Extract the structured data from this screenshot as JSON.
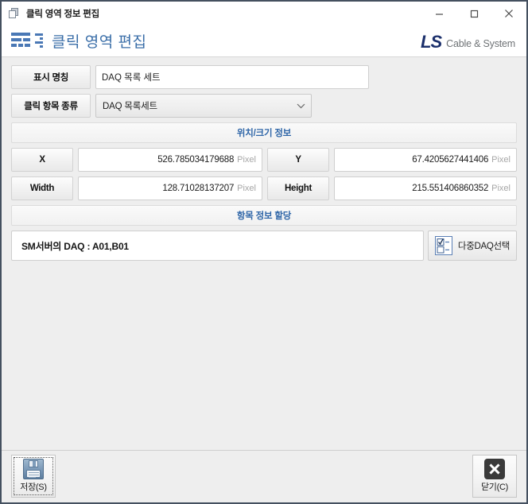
{
  "window": {
    "title": "클릭 영역 정보 편집",
    "title_icon": "copy-pages-icon",
    "controls": {
      "minimize": "minimize-icon",
      "maximize": "maximize-icon",
      "close": "close-icon"
    }
  },
  "header": {
    "icon": "list-bars-icon",
    "title": "클릭 영역 편집",
    "logo": {
      "mark": "LS",
      "text": "Cable & System",
      "mark_color": "#1b2f6b",
      "swoosh_color": "#e2182b",
      "text_color": "#6f7376"
    }
  },
  "form": {
    "display_name": {
      "label": "표시 명칭",
      "value": "DAQ 목록 세트",
      "placeholder": ""
    },
    "click_item_type": {
      "label": "클릭 항목 종류",
      "value": "DAQ 목록세트",
      "options": [
        "DAQ 목록세트"
      ],
      "chevron": "chevron-down-icon"
    }
  },
  "position_section": {
    "title": "위치/크기 정보",
    "accent_color": "#2f66a8",
    "unit": "Pixel",
    "fields": [
      {
        "label": "X",
        "value": "526.785034179688",
        "unit": "Pixel"
      },
      {
        "label": "Y",
        "value": "67.4205627441406",
        "unit": "Pixel"
      },
      {
        "label": "Width",
        "value": "128.71028137207",
        "unit": "Pixel"
      },
      {
        "label": "Height",
        "value": "215.551406860352",
        "unit": "Pixel"
      }
    ]
  },
  "assign_section": {
    "title": "항목 정보 할당",
    "assigned_text": "SM서버의 DAQ : A01,B01",
    "multi_daq_button": {
      "label": "다중DAQ선택",
      "icon": "checklist-icon"
    }
  },
  "footer": {
    "save": {
      "label": "저장(S)",
      "icon": "floppy-disk-icon"
    },
    "close": {
      "label": "닫기(C)",
      "icon": "close-x-icon"
    }
  }
}
